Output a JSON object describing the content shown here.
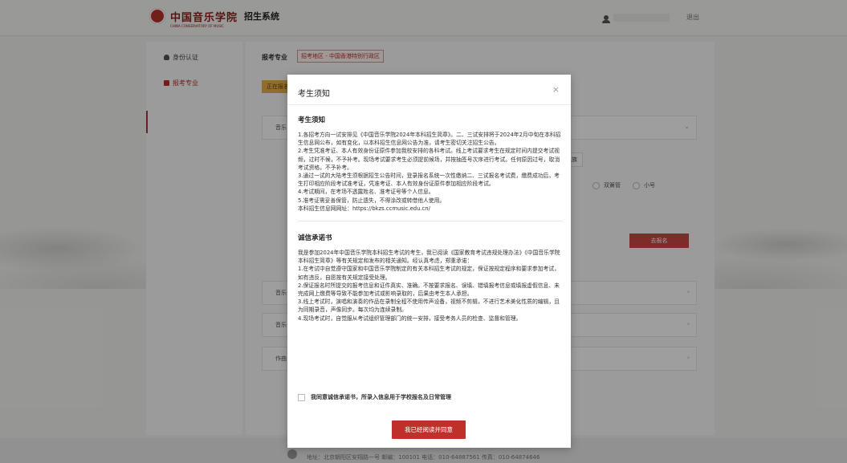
{
  "header": {
    "logo_text": "中国音乐学院",
    "logo_subtext": "CHINA CONSERVATORY OF MUSIC",
    "system_title": "招生系统",
    "logout_label": "退出"
  },
  "sidebar": {
    "items": [
      {
        "label": "身份认证",
        "icon": "shield-icon"
      },
      {
        "label": "报考专业",
        "icon": "document-icon"
      }
    ]
  },
  "main": {
    "major_label": "报考专业",
    "region_tag": "招考地区 - 中国香港特别行政区",
    "status_tag": "正在报名",
    "section_rows": [
      "音乐",
      "音乐",
      "音乐",
      "作曲"
    ],
    "instrument_options": [
      "双簧管",
      "小号"
    ],
    "other_tag": "民族",
    "apply_button": "去报名"
  },
  "footer": {
    "address": "地址：北京朝阳区安翔路一号 邮编：100101 电话：010-64887561 传真：010-64874646"
  },
  "modal": {
    "title": "考生须知",
    "notice_title": "考生须知",
    "notice_text": "1.各招考方向一试安排见《中国音乐学院2024年本科招生简章》。二、三试安排将于2024年2月中旬在本科招生信息网公布，如有变化，以本科招生信息网公告为准，请考生密切关注招生公告。\n2.考生凭准考证、本人有效身份证原件参加我校安排的各科考试。线上考试要求考生在规定时间内提交考试视频，过时不候，不予补考。现场考试要求考生必须提前候场，并按抽签号次序进行考试。任何原因过号，取消考试资格，不予补考。\n3.通过一试的大陆考生须根据招生公告时间，登录报名系统一次性缴纳二、三试报名考试费，缴费成功后，考生打印相应阶段考试准考证，凭准考证、本人有效身份证原件参加相应阶段考试。\n4.考试期间，在考场不透露姓名、准考证号等个人信息。\n5.准考证需妥善保管，防止遗失，不得涂改或转借他人使用。\n本科招生信息网网址：https://bkzs.ccmusic.edu.cn/",
    "pledge_title": "诚信承诺书",
    "pledge_text": "我是参加2024年中国音乐学院本科招生考试的考生，我已阅读《国家教育考试违规处理办法》《中国音乐学院本科招生简章》等有关规定和发布的相关通知。经认真考虑，郑重承诺：\n1.在考试中自觉遵守国家和中国音乐学院制定的有关本科招生考试的规定，保证按规定程序和要求参加考试，如有违反，自愿按有关规定接受处理。\n2.保证报名时所提交的报考信息和证件真实、准确。不按要求报名、误填、错填报考信息或填报虚假信息、未完成网上缴费等导致不能参加考试或影响录取的，后果由考生本人承担。\n3.线上考试时，演唱和演奏的作品在录制全程不使用传声设备，视频不剪辑，不进行艺术美化性质的编辑，且为同期录音，声像同步。每次均为连续录制。\n4.现场考试时，自觉服从考试组织管理部门的统一安排，接受考务人员的检查、监督和管理。",
    "agree_label": "我同意诚信承诺书，所录入信息用于学校报名及日常管理",
    "confirm_button": "我已经阅读并同意",
    "close_glyph": "×"
  }
}
